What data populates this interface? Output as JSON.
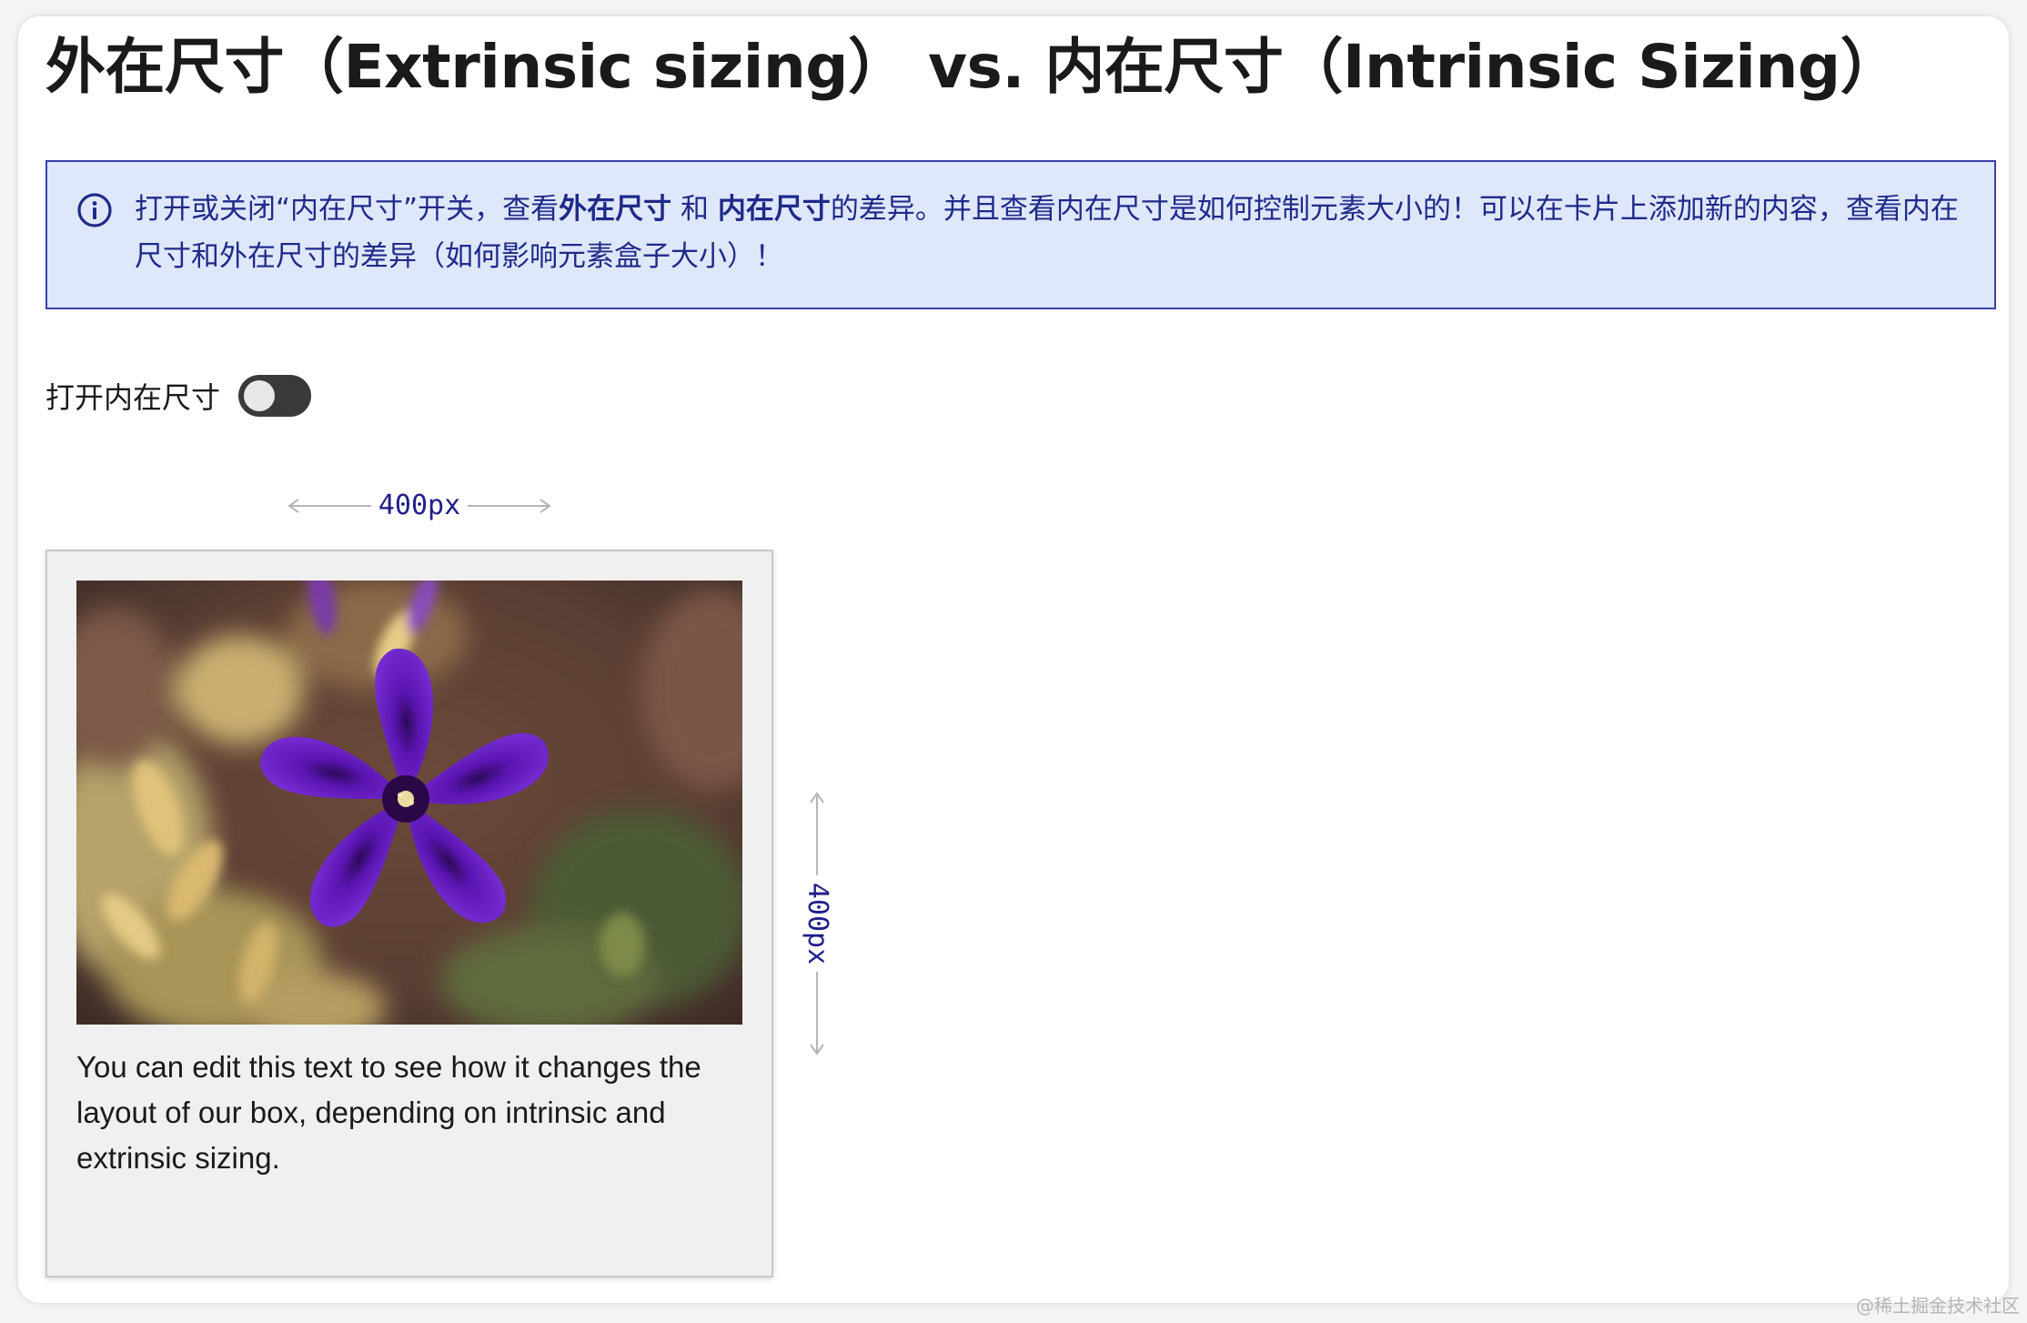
{
  "page": {
    "title": "外在尺寸（Extrinsic sizing） vs. 内在尺寸（Intrinsic Sizing）"
  },
  "callout": {
    "icon": "info-icon",
    "text_before": "打开或关闭“内在尺寸”开关，查看",
    "bold_extrinsic": "外在尺寸",
    "text_and": " 和 ",
    "bold_intrinsic": "内在尺寸",
    "text_after": "的差异。并且查看内在尺寸是如何控制元素大小的！可以在卡片上添加新的内容，查看内在尺寸和外在尺寸的差异（如何影响元素盒子大小）！",
    "colors": {
      "background": "#dfe8fb",
      "border": "#3b3fa8",
      "text": "#1f2a8a"
    }
  },
  "toggle": {
    "label": "打开内在尺寸",
    "checked": false
  },
  "dimensions": {
    "width_label": "400px",
    "height_label": "400px"
  },
  "card": {
    "image": "purple-petunia-flower-photo",
    "caption": "You can edit this text to see how it changes the layout of our box, depending on intrinsic and extrinsic sizing."
  },
  "watermark": "@稀土掘金技术社区"
}
